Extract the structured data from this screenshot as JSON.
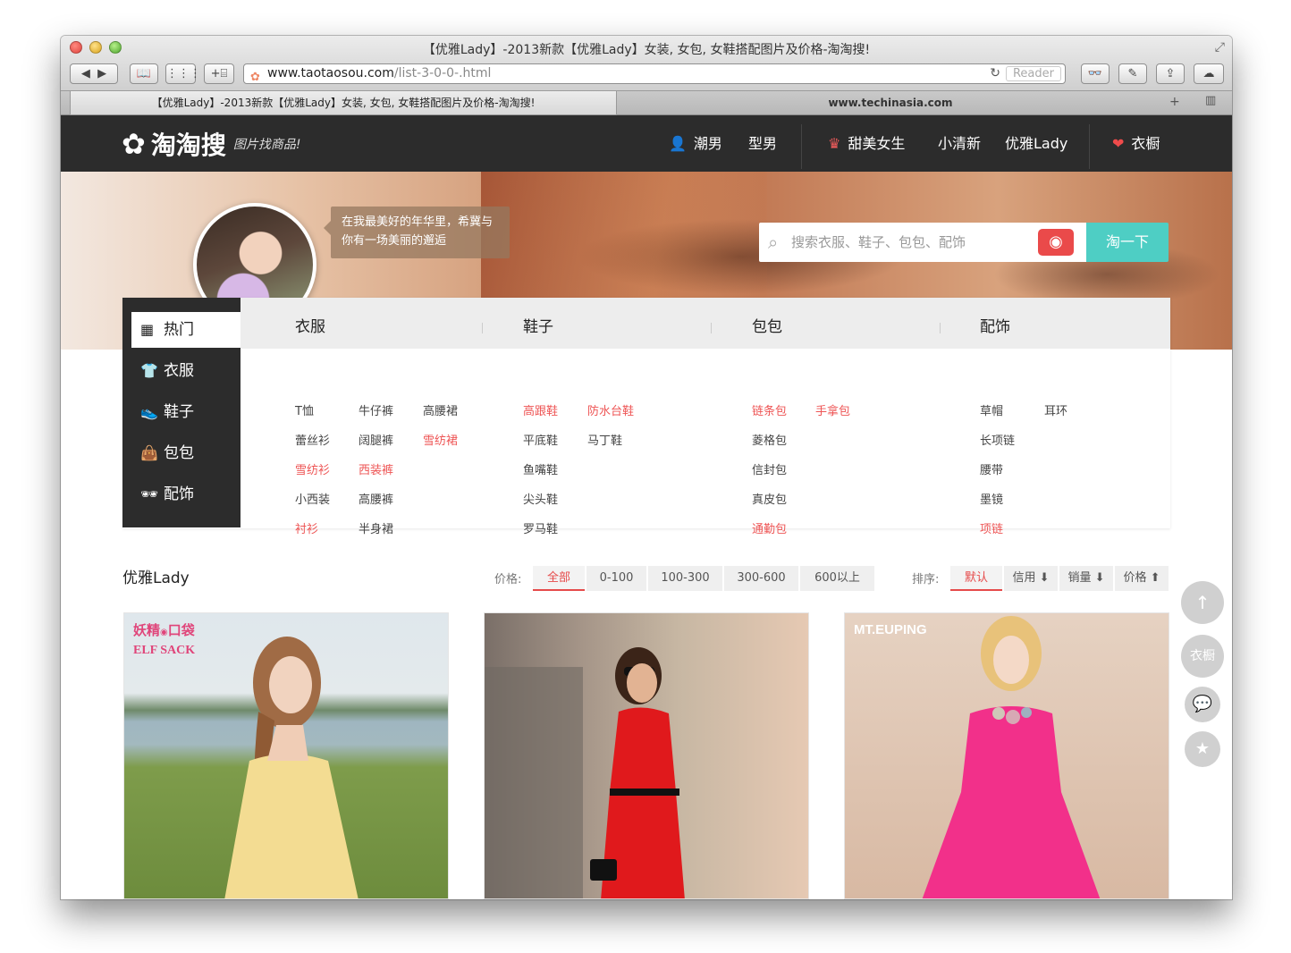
{
  "browser": {
    "window_title": "【优雅Lady】-2013新款【优雅Lady】女装, 女包, 女鞋搭配图片及价格-淘淘搜!",
    "url_domain": "www.taotaosou.com",
    "url_path": "/list-3-0-0-.html",
    "reader_label": "Reader",
    "tabs": [
      {
        "label": "【优雅Lady】-2013新款【优雅Lady】女装, 女包, 女鞋搭配图片及价格-淘淘搜!"
      },
      {
        "label": "www.techinasia.com"
      }
    ],
    "toolbar_icons": [
      "back-icon",
      "forward-icon",
      "bookmarks-icon",
      "top-sites-icon",
      "add-bookmark-icon",
      "reading-list-icon",
      "share-icon",
      "icloud-icon"
    ]
  },
  "site": {
    "logo_text": "淘淘搜",
    "slogan": "图片找商品!",
    "nav": [
      {
        "label": "潮男"
      },
      {
        "label": "型男"
      },
      {
        "label": "甜美女生"
      },
      {
        "label": "小清新"
      },
      {
        "label": "优雅Lady"
      },
      {
        "label": "衣橱"
      }
    ],
    "colors": {
      "header_bg": "#2c2c2c",
      "accent_red": "#ee5555",
      "search_btn": "#4ecec4"
    }
  },
  "hero": {
    "quote": "在我最美好的年华里，希冀与你有一场美丽的邂逅",
    "search_placeholder": "搜索衣服、鞋子、包包、配饰",
    "search_button": "淘一下"
  },
  "sidebar": {
    "items": [
      {
        "label": "热门",
        "icon": "grid-icon"
      },
      {
        "label": "衣服",
        "icon": "tshirt-icon"
      },
      {
        "label": "鞋子",
        "icon": "shoe-icon"
      },
      {
        "label": "包包",
        "icon": "bag-icon"
      },
      {
        "label": "配饰",
        "icon": "glasses-icon"
      }
    ]
  },
  "categories": [
    {
      "title": "衣服",
      "links": [
        {
          "label": "T恤",
          "hot": false
        },
        {
          "label": "牛仔裤",
          "hot": false
        },
        {
          "label": "高腰裙",
          "hot": false
        },
        {
          "label": "蕾丝衫",
          "hot": false
        },
        {
          "label": "阔腿裤",
          "hot": false
        },
        {
          "label": "雪纺裙",
          "hot": true
        },
        {
          "label": "雪纺衫",
          "hot": true
        },
        {
          "label": "西装裤",
          "hot": true
        },
        {
          "label": "小西装",
          "hot": false
        },
        {
          "label": "高腰裤",
          "hot": false
        },
        {
          "label": "衬衫",
          "hot": true
        },
        {
          "label": "半身裙",
          "hot": false
        }
      ]
    },
    {
      "title": "鞋子",
      "links": [
        {
          "label": "高跟鞋",
          "hot": true
        },
        {
          "label": "防水台鞋",
          "hot": true
        },
        {
          "label": "平底鞋",
          "hot": false
        },
        {
          "label": "马丁鞋",
          "hot": false
        },
        {
          "label": "鱼嘴鞋",
          "hot": false
        },
        {
          "label": "尖头鞋",
          "hot": false
        },
        {
          "label": "罗马鞋",
          "hot": false
        }
      ]
    },
    {
      "title": "包包",
      "links": [
        {
          "label": "链条包",
          "hot": true
        },
        {
          "label": "手拿包",
          "hot": true
        },
        {
          "label": "菱格包",
          "hot": false
        },
        {
          "label": "信封包",
          "hot": false
        },
        {
          "label": "真皮包",
          "hot": false
        },
        {
          "label": "通勤包",
          "hot": true
        }
      ]
    },
    {
      "title": "配饰",
      "links": [
        {
          "label": "草帽",
          "hot": false
        },
        {
          "label": "耳环",
          "hot": false
        },
        {
          "label": "长项链",
          "hot": false
        },
        {
          "label": "腰带",
          "hot": false
        },
        {
          "label": "墨镜",
          "hot": false
        },
        {
          "label": "项链",
          "hot": true
        }
      ]
    }
  ],
  "listing": {
    "title": "优雅Lady",
    "price_label": "价格:",
    "price_filters": [
      "全部",
      "0-100",
      "100-300",
      "300-600",
      "600以上"
    ],
    "sort_label": "排序:",
    "sort_options": [
      "默认",
      "信用 ⬇",
      "销量 ⬇",
      "价格 ⬆"
    ],
    "products": [
      {
        "brand": "妖精の口袋\nELF SACK",
        "dress_color": "#f3dc92"
      },
      {
        "brand": "",
        "dress_color": "#e0191c"
      },
      {
        "brand": "MT.EUPING",
        "dress_color": "#f2308a"
      }
    ]
  },
  "float_tools": {
    "wardrobe_label": "衣橱",
    "icons": [
      "arrow-up-icon",
      "wardrobe-icon",
      "chat-icon",
      "star-icon"
    ]
  }
}
